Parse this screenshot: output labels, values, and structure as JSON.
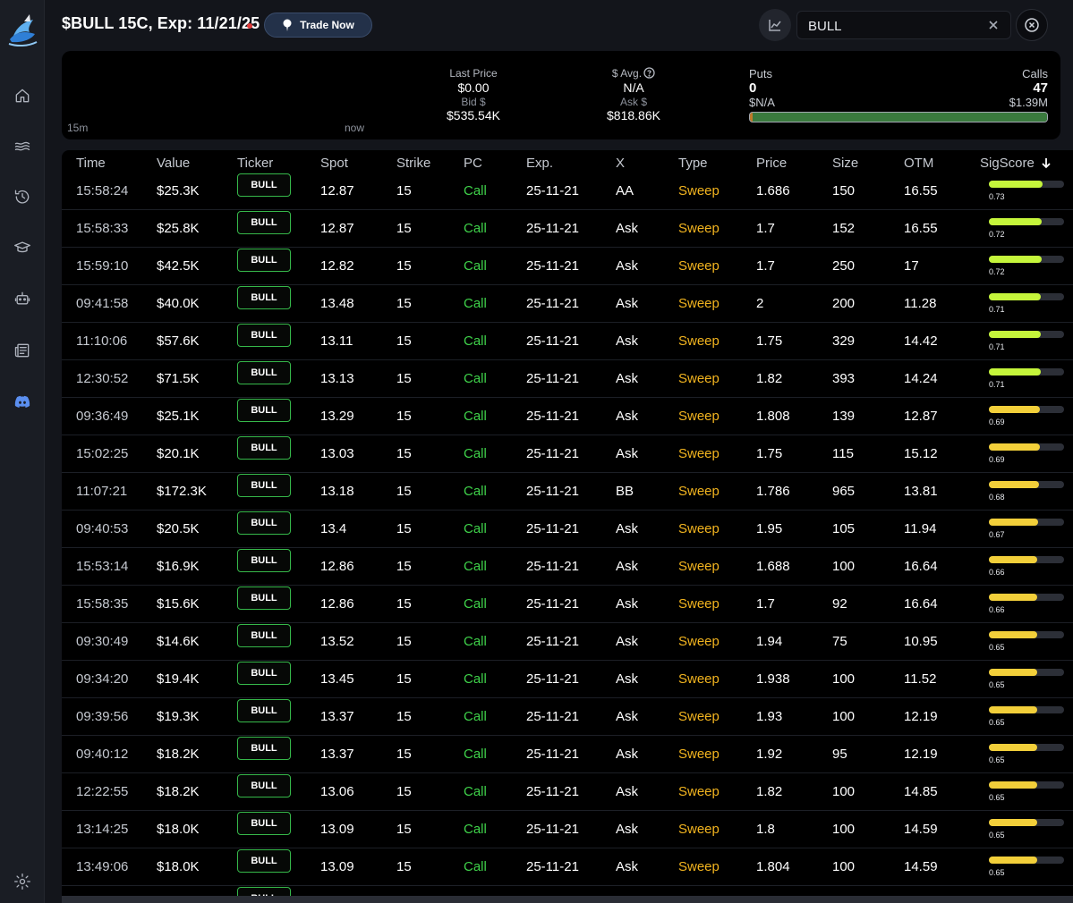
{
  "header": {
    "title": "$BULL 15C, Exp: 11/21/25",
    "trade_label": "Trade Now"
  },
  "search": {
    "value": "BULL"
  },
  "colors": {
    "call": "#3fd24a",
    "sweep": "#f2b41f",
    "sig_high": "#c5f53b",
    "sig_mid": "#f2cf3a",
    "live_dot": "#e23b3b"
  },
  "sidebar": {
    "items": [
      "home-icon",
      "waves-icon",
      "history-icon",
      "graduation-cap-icon",
      "robot-icon",
      "newspaper-icon",
      "discord-icon"
    ],
    "bottom": "gear-icon"
  },
  "summary": {
    "range_start": "15m",
    "range_end": "now",
    "last_price_label": "Last Price",
    "last_price": "$0.00",
    "bid_label": "Bid $",
    "bid": "$535.54K",
    "avg_label": "$ Avg.",
    "avg": "N/A",
    "ask_label": "Ask $",
    "ask": "$818.86K",
    "puts_label": "Puts",
    "puts_count": "0",
    "puts_amount": "$N/A",
    "calls_label": "Calls",
    "calls_count": "47",
    "calls_amount": "$1.39M",
    "puts_share": 0.01
  },
  "table": {
    "columns": [
      "Time",
      "Value",
      "Ticker",
      "Spot",
      "Strike",
      "PC",
      "Exp.",
      "X",
      "Type",
      "Price",
      "Size",
      "OTM",
      "SigScore"
    ],
    "rows": [
      {
        "time": "15:58:24",
        "value": "$25.3K",
        "ticker": "BULL",
        "spot": "12.87",
        "strike": "15",
        "pc": "Call",
        "exp": "25-11-21",
        "x": "AA",
        "type": "Sweep",
        "price": "1.686",
        "size": "150",
        "otm": "16.55",
        "sig": "0.73"
      },
      {
        "time": "15:58:33",
        "value": "$25.8K",
        "ticker": "BULL",
        "spot": "12.87",
        "strike": "15",
        "pc": "Call",
        "exp": "25-11-21",
        "x": "Ask",
        "type": "Sweep",
        "price": "1.7",
        "size": "152",
        "otm": "16.55",
        "sig": "0.72"
      },
      {
        "time": "15:59:10",
        "value": "$42.5K",
        "ticker": "BULL",
        "spot": "12.82",
        "strike": "15",
        "pc": "Call",
        "exp": "25-11-21",
        "x": "Ask",
        "type": "Sweep",
        "price": "1.7",
        "size": "250",
        "otm": "17",
        "sig": "0.72"
      },
      {
        "time": "09:41:58",
        "value": "$40.0K",
        "ticker": "BULL",
        "spot": "13.48",
        "strike": "15",
        "pc": "Call",
        "exp": "25-11-21",
        "x": "Ask",
        "type": "Sweep",
        "price": "2",
        "size": "200",
        "otm": "11.28",
        "sig": "0.71"
      },
      {
        "time": "11:10:06",
        "value": "$57.6K",
        "ticker": "BULL",
        "spot": "13.11",
        "strike": "15",
        "pc": "Call",
        "exp": "25-11-21",
        "x": "Ask",
        "type": "Sweep",
        "price": "1.75",
        "size": "329",
        "otm": "14.42",
        "sig": "0.71"
      },
      {
        "time": "12:30:52",
        "value": "$71.5K",
        "ticker": "BULL",
        "spot": "13.13",
        "strike": "15",
        "pc": "Call",
        "exp": "25-11-21",
        "x": "Ask",
        "type": "Sweep",
        "price": "1.82",
        "size": "393",
        "otm": "14.24",
        "sig": "0.71"
      },
      {
        "time": "09:36:49",
        "value": "$25.1K",
        "ticker": "BULL",
        "spot": "13.29",
        "strike": "15",
        "pc": "Call",
        "exp": "25-11-21",
        "x": "Ask",
        "type": "Sweep",
        "price": "1.808",
        "size": "139",
        "otm": "12.87",
        "sig": "0.69"
      },
      {
        "time": "15:02:25",
        "value": "$20.1K",
        "ticker": "BULL",
        "spot": "13.03",
        "strike": "15",
        "pc": "Call",
        "exp": "25-11-21",
        "x": "Ask",
        "type": "Sweep",
        "price": "1.75",
        "size": "115",
        "otm": "15.12",
        "sig": "0.69"
      },
      {
        "time": "11:07:21",
        "value": "$172.3K",
        "ticker": "BULL",
        "spot": "13.18",
        "strike": "15",
        "pc": "Call",
        "exp": "25-11-21",
        "x": "BB",
        "type": "Sweep",
        "price": "1.786",
        "size": "965",
        "otm": "13.81",
        "sig": "0.68"
      },
      {
        "time": "09:40:53",
        "value": "$20.5K",
        "ticker": "BULL",
        "spot": "13.4",
        "strike": "15",
        "pc": "Call",
        "exp": "25-11-21",
        "x": "Ask",
        "type": "Sweep",
        "price": "1.95",
        "size": "105",
        "otm": "11.94",
        "sig": "0.67"
      },
      {
        "time": "15:53:14",
        "value": "$16.9K",
        "ticker": "BULL",
        "spot": "12.86",
        "strike": "15",
        "pc": "Call",
        "exp": "25-11-21",
        "x": "Ask",
        "type": "Sweep",
        "price": "1.688",
        "size": "100",
        "otm": "16.64",
        "sig": "0.66"
      },
      {
        "time": "15:58:35",
        "value": "$15.6K",
        "ticker": "BULL",
        "spot": "12.86",
        "strike": "15",
        "pc": "Call",
        "exp": "25-11-21",
        "x": "Ask",
        "type": "Sweep",
        "price": "1.7",
        "size": "92",
        "otm": "16.64",
        "sig": "0.66"
      },
      {
        "time": "09:30:49",
        "value": "$14.6K",
        "ticker": "BULL",
        "spot": "13.52",
        "strike": "15",
        "pc": "Call",
        "exp": "25-11-21",
        "x": "Ask",
        "type": "Sweep",
        "price": "1.94",
        "size": "75",
        "otm": "10.95",
        "sig": "0.65"
      },
      {
        "time": "09:34:20",
        "value": "$19.4K",
        "ticker": "BULL",
        "spot": "13.45",
        "strike": "15",
        "pc": "Call",
        "exp": "25-11-21",
        "x": "Ask",
        "type": "Sweep",
        "price": "1.938",
        "size": "100",
        "otm": "11.52",
        "sig": "0.65"
      },
      {
        "time": "09:39:56",
        "value": "$19.3K",
        "ticker": "BULL",
        "spot": "13.37",
        "strike": "15",
        "pc": "Call",
        "exp": "25-11-21",
        "x": "Ask",
        "type": "Sweep",
        "price": "1.93",
        "size": "100",
        "otm": "12.19",
        "sig": "0.65"
      },
      {
        "time": "09:40:12",
        "value": "$18.2K",
        "ticker": "BULL",
        "spot": "13.37",
        "strike": "15",
        "pc": "Call",
        "exp": "25-11-21",
        "x": "Ask",
        "type": "Sweep",
        "price": "1.92",
        "size": "95",
        "otm": "12.19",
        "sig": "0.65"
      },
      {
        "time": "12:22:55",
        "value": "$18.2K",
        "ticker": "BULL",
        "spot": "13.06",
        "strike": "15",
        "pc": "Call",
        "exp": "25-11-21",
        "x": "Ask",
        "type": "Sweep",
        "price": "1.82",
        "size": "100",
        "otm": "14.85",
        "sig": "0.65"
      },
      {
        "time": "13:14:25",
        "value": "$18.0K",
        "ticker": "BULL",
        "spot": "13.09",
        "strike": "15",
        "pc": "Call",
        "exp": "25-11-21",
        "x": "Ask",
        "type": "Sweep",
        "price": "1.8",
        "size": "100",
        "otm": "14.59",
        "sig": "0.65"
      },
      {
        "time": "13:49:06",
        "value": "$18.0K",
        "ticker": "BULL",
        "spot": "13.09",
        "strike": "15",
        "pc": "Call",
        "exp": "25-11-21",
        "x": "Ask",
        "type": "Sweep",
        "price": "1.804",
        "size": "100",
        "otm": "14.59",
        "sig": "0.65"
      },
      {
        "time": "",
        "value": "",
        "ticker": "BULL",
        "spot": "",
        "strike": "",
        "pc": "",
        "exp": "",
        "x": "",
        "type": "",
        "price": "",
        "size": "",
        "otm": "",
        "sig": ""
      }
    ]
  }
}
